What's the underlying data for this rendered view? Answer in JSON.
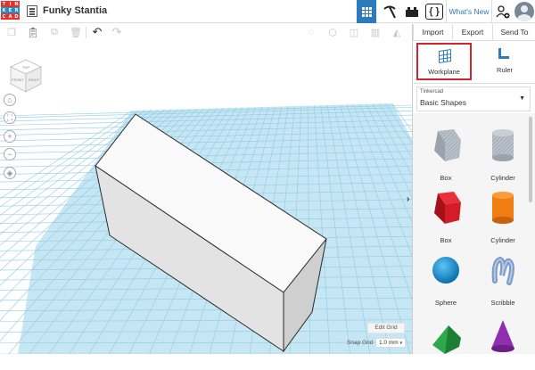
{
  "app": {
    "logo_letters": [
      "T",
      "I",
      "N",
      "K",
      "E",
      "R",
      "C",
      "A",
      "D"
    ],
    "logo_colors": [
      "#e5322d",
      "#e5322d",
      "#e5322d",
      "#1f8ec9",
      "#1f8ec9",
      "#1f8ec9",
      "#e5322d",
      "#e5322d",
      "#e5322d"
    ],
    "design_title": "Funky Stantia",
    "whats_new": "What's New",
    "braces_label": "{ }",
    "accent": "#2b7bbd",
    "highlight": "#d0262e"
  },
  "panel": {
    "import": "Import",
    "export": "Export",
    "send_to": "Send To",
    "workplane": "Workplane",
    "ruler": "Ruler",
    "library_brand": "Tinkercad",
    "library_name": "Basic Shapes",
    "shapes": [
      {
        "label": "Box",
        "icon": "box-striped-icon"
      },
      {
        "label": "Cylinder",
        "icon": "cylinder-striped-icon"
      },
      {
        "label": "Box",
        "icon": "box-red-icon"
      },
      {
        "label": "Cylinder",
        "icon": "cylinder-orange-icon"
      },
      {
        "label": "Sphere",
        "icon": "sphere-blue-icon"
      },
      {
        "label": "Scribble",
        "icon": "scribble-icon"
      },
      {
        "label": "",
        "icon": "roof-green-icon"
      },
      {
        "label": "",
        "icon": "cone-purple-icon"
      }
    ]
  },
  "viewport": {
    "cube_top": "TOP",
    "cube_front": "FRONT",
    "cube_right": "RIGHT",
    "edit_grid": "Edit Grid",
    "snap_grid_label": "Snap Grid",
    "snap_grid_value": "1.0 mm"
  }
}
